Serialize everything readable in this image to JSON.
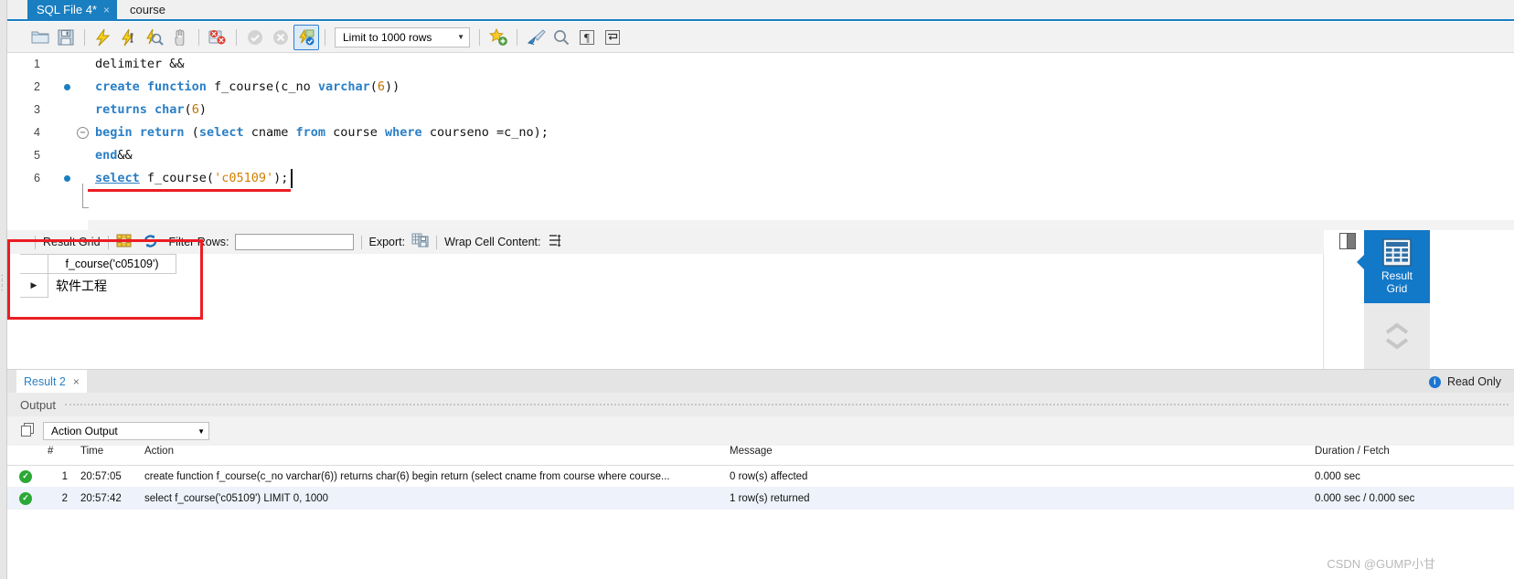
{
  "tabs": {
    "active": {
      "label": "SQL File 4*",
      "close": "×"
    },
    "inactive": {
      "label": "course"
    }
  },
  "editor_toolbar": {
    "buttons": [
      {
        "name": "open-sql-script",
        "icon": "folder-icon"
      },
      {
        "name": "save-sql-script",
        "icon": "floppy-disk-icon"
      },
      {
        "name": "execute-statement",
        "icon": "lightning-icon"
      },
      {
        "name": "execute-current-statement",
        "icon": "lightning-cursor-icon"
      },
      {
        "name": "explain-statement",
        "icon": "lightning-magnifier-icon"
      },
      {
        "name": "stop-script",
        "icon": "hand-icon"
      },
      {
        "name": "toggle-stop-on-error",
        "icon": "stop-on-error-icon"
      },
      {
        "name": "commit",
        "icon": "check-circle-icon"
      },
      {
        "name": "rollback",
        "icon": "cancel-circle-icon"
      },
      {
        "name": "toggle-autocommit",
        "icon": "autocommit-icon"
      },
      {
        "name": "toggle-auto-complete",
        "icon": "star-plus-icon"
      },
      {
        "name": "beautify-query",
        "icon": "broom-icon"
      },
      {
        "name": "find",
        "icon": "magnifier-icon"
      },
      {
        "name": "toggle-invisible-characters",
        "icon": "pilcrow-icon"
      },
      {
        "name": "toggle-wrapping",
        "icon": "wrap-arrow-icon"
      }
    ],
    "limit_select": {
      "value": "Limit to 1000 rows",
      "caret": "▼"
    }
  },
  "code": {
    "lines": [
      {
        "number": "1",
        "breakpoint": false,
        "text": "delimiter &&",
        "tokens": [
          {
            "t": "plain",
            "v": "delimiter &&"
          }
        ]
      },
      {
        "number": "2",
        "breakpoint": true,
        "text": "create function f_course(c_no varchar(6))",
        "tokens": [
          {
            "t": "kw",
            "v": "create function"
          },
          {
            "t": "plain",
            "v": " f_course(c_no "
          },
          {
            "t": "kw",
            "v": "varchar"
          },
          {
            "t": "plain",
            "v": "("
          },
          {
            "t": "num",
            "v": "6"
          },
          {
            "t": "plain",
            "v": "))"
          }
        ]
      },
      {
        "number": "3",
        "breakpoint": false,
        "text": "returns char(6)",
        "tokens": [
          {
            "t": "kw",
            "v": "returns char"
          },
          {
            "t": "plain",
            "v": "("
          },
          {
            "t": "num",
            "v": "6"
          },
          {
            "t": "plain",
            "v": ")"
          }
        ]
      },
      {
        "number": "4",
        "breakpoint": false,
        "text": "begin return (select cname from course where courseno =c_no);",
        "tokens": [
          {
            "t": "kw",
            "v": "begin return"
          },
          {
            "t": "plain",
            "v": " ("
          },
          {
            "t": "kw",
            "v": "select"
          },
          {
            "t": "plain",
            "v": " cname "
          },
          {
            "t": "kw",
            "v": "from"
          },
          {
            "t": "plain",
            "v": " course "
          },
          {
            "t": "kw",
            "v": "where"
          },
          {
            "t": "plain",
            "v": " courseno =c_no);"
          }
        ]
      },
      {
        "number": "5",
        "breakpoint": false,
        "text": "end&&",
        "tokens": [
          {
            "t": "kw",
            "v": "end"
          },
          {
            "t": "plain",
            "v": "&&"
          }
        ]
      },
      {
        "number": "6",
        "breakpoint": true,
        "text": "select f_course('c05109');",
        "tokens": [
          {
            "t": "kw",
            "v": "select"
          },
          {
            "t": "plain",
            "v": " f_course("
          },
          {
            "t": "str",
            "v": "'c05109'"
          },
          {
            "t": "plain",
            "v": ");"
          }
        ]
      }
    ]
  },
  "results_toolbar": {
    "result_grid_label": "Result Grid",
    "filter_rows_label": "Filter Rows:",
    "filter_rows_value": "",
    "export_label": "Export:",
    "wrap_cell_content_label": "Wrap Cell Content:",
    "icons": {
      "grid_view": "grid-view-icon",
      "refresh": "refresh-icon",
      "export": "export-icon",
      "wrap": "wrap-cell-icon"
    }
  },
  "result_grid": {
    "columns": [
      "f_course('c05109')"
    ],
    "rows": [
      {
        "marker": "▶",
        "cells": [
          "软件工程"
        ]
      }
    ]
  },
  "right_sidebar": {
    "panel_toggle": "toggle-sidebar-icon",
    "result_grid_button": {
      "line1": "Result",
      "line2": "Grid",
      "icon": "grid-table-icon"
    },
    "chevrons": "⌃"
  },
  "result_tabstrip": {
    "tab_label": "Result 2",
    "tab_close": "×",
    "read_only": "Read Only",
    "info_icon": "i"
  },
  "output_panel": {
    "title": "Output",
    "selector_value": "Action Output",
    "selector_caret": "▼",
    "selector_icon": "panes-icon",
    "columns": [
      "#",
      "Time",
      "Action",
      "Message",
      "Duration / Fetch"
    ],
    "rows": [
      {
        "status": "success",
        "num": "1",
        "time": "20:57:05",
        "action": "create function f_course(c_no varchar(6)) returns char(6) begin return (select cname from course where course...",
        "message": "0 row(s) affected",
        "duration": "0.000 sec"
      },
      {
        "status": "success",
        "num": "2",
        "time": "20:57:42",
        "action": "select f_course('c05109') LIMIT 0, 1000",
        "message": "1 row(s) returned",
        "duration": "0.000 sec / 0.000 sec"
      }
    ]
  },
  "watermark": "CSDN @GUMP小甘",
  "colors": {
    "accent": "#1a7fc1",
    "annotation": "#ec1c24",
    "keyword": "#2a7fc6",
    "string": "#d18000",
    "number": "#c07000",
    "success": "#2ba836"
  }
}
